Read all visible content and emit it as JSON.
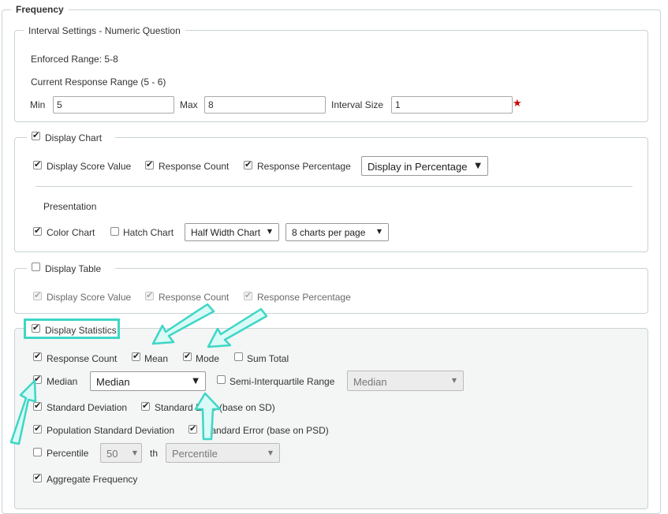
{
  "frequency": {
    "title": "Frequency",
    "interval": {
      "legend": "Interval Settings - Numeric Question",
      "enforced_range": "Enforced Range: 5-8",
      "current_range": "Current Response Range (5 - 6)",
      "min_label": "Min",
      "min_value": "5",
      "max_label": "Max",
      "max_value": "8",
      "interval_label": "Interval Size",
      "interval_value": "1",
      "required_mark": "★"
    },
    "display_chart": {
      "legend": "Display Chart",
      "checked": true,
      "score_value": "Display Score Value",
      "response_count": "Response Count",
      "response_percentage": "Response Percentage",
      "display_mode": "Display in Percentage",
      "presentation_label": "Presentation",
      "color_chart": "Color Chart",
      "hatch_chart": "Hatch Chart",
      "width_select": "Half Width Chart",
      "per_page_select": "8 charts per page"
    },
    "display_table": {
      "legend": "Display Table",
      "checked": false,
      "score_value": "Display Score Value",
      "response_count": "Response Count",
      "response_percentage": "Response Percentage"
    },
    "display_statistics": {
      "legend": "Display Statistics",
      "checked": true,
      "response_count": "Response Count",
      "mean": "Mean",
      "mode": "Mode",
      "sum_total": "Sum Total",
      "median": "Median",
      "median_select": "Median",
      "semi_iqr": "Semi-Interquartile Range",
      "semi_iqr_select": "Median",
      "std_dev": "Standard Deviation",
      "std_err_sd": "Standard Error (base on SD)",
      "pop_std_dev": "Population Standard Deviation",
      "std_err_psd": "Standard Error (base on PSD)",
      "percentile": "Percentile",
      "percentile_value": "50",
      "th": "th",
      "percentile_select": "Percentile",
      "aggregate": "Aggregate Frequency"
    }
  },
  "colors": {
    "highlight": "#3ed6c6",
    "arrow_fill": "#d9faf6",
    "required": "#cc0000"
  }
}
